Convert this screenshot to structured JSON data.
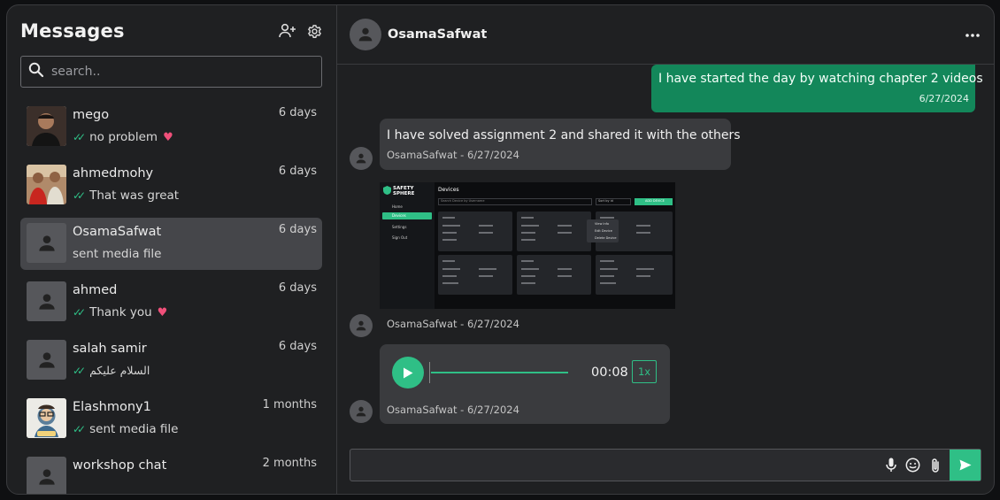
{
  "sidebar": {
    "title": "Messages",
    "search_placeholder": "search..",
    "chats": [
      {
        "name": "mego",
        "time": "6 days",
        "last": "no problem",
        "ticks": true,
        "heart": true,
        "avatar": "photo"
      },
      {
        "name": "ahmedmohy",
        "time": "6 days",
        "last": "That was great",
        "ticks": true,
        "heart": false,
        "avatar": "photo"
      },
      {
        "name": "OsamaSafwat",
        "time": "6 days",
        "last": "sent media file",
        "ticks": false,
        "heart": false,
        "avatar": "default",
        "active": true
      },
      {
        "name": "ahmed",
        "time": "6 days",
        "last": "Thank you",
        "ticks": true,
        "heart": true,
        "avatar": "default"
      },
      {
        "name": "salah samir",
        "time": "6 days",
        "last": "السلام عليكم",
        "ticks": true,
        "heart": false,
        "avatar": "default"
      },
      {
        "name": "Elashmony1",
        "time": "1 months",
        "last": "sent media file",
        "ticks": true,
        "heart": false,
        "avatar": "cartoon"
      },
      {
        "name": "workshop chat",
        "time": "2 months",
        "last": "",
        "ticks": false,
        "heart": false,
        "avatar": "default"
      }
    ]
  },
  "conversation": {
    "contact_name": "OsamaSafwat",
    "outgoing": {
      "text": "I have started the day by watching chapter 2 videos",
      "date": "6/27/2024"
    },
    "incoming_text": {
      "text": "I have solved assignment 2 and shared it with the others",
      "meta": "OsamaSafwat - 6/27/2024"
    },
    "incoming_media": {
      "meta": "OsamaSafwat - 6/27/2024",
      "preview": {
        "brand": "SAFETY SPHERE",
        "heading": "Devices",
        "nav": [
          "Home",
          "Devices",
          "Settings",
          "Sign Out"
        ],
        "search_placeholder": "Search Device by Username",
        "sort": "Sort by id",
        "add_button": "ADD DEVICE",
        "menu": [
          "View Info",
          "Edit Device",
          "Delete Device"
        ]
      }
    },
    "incoming_audio": {
      "time": "00:08",
      "speed": "1x",
      "meta": "OsamaSafwat - 6/27/2024"
    }
  },
  "colors": {
    "accent": "#2fbf86",
    "outgoing_bubble": "#13875a",
    "incoming_bubble": "#3a3b3e",
    "heart": "#f0507a"
  }
}
